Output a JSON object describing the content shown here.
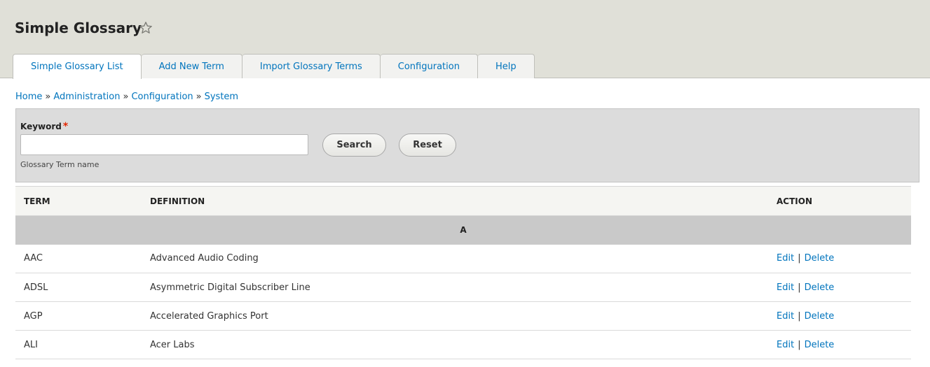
{
  "header": {
    "title": "Simple Glossary",
    "tabs": [
      {
        "label": "Simple Glossary List",
        "active": true
      },
      {
        "label": "Add New Term",
        "active": false
      },
      {
        "label": "Import Glossary Terms",
        "active": false
      },
      {
        "label": "Configuration",
        "active": false
      },
      {
        "label": "Help",
        "active": false
      }
    ]
  },
  "breadcrumb": [
    "Home",
    "Administration",
    "Configuration",
    "System"
  ],
  "breadcrumb_separator": "»",
  "search": {
    "label": "Keyword",
    "required_marker": "*",
    "value": "",
    "description": "Glossary Term name",
    "search_label": "Search",
    "reset_label": "Reset"
  },
  "table": {
    "headers": {
      "term": "TERM",
      "definition": "DEFINITION",
      "action": "ACTION"
    },
    "group_letter": "A",
    "rows": [
      {
        "term": "AAC",
        "definition": "Advanced Audio Coding",
        "edit": "Edit",
        "sep": "|",
        "delete": "Delete"
      },
      {
        "term": "ADSL",
        "definition": "Asymmetric Digital Subscriber Line",
        "edit": "Edit",
        "sep": "|",
        "delete": "Delete"
      },
      {
        "term": "AGP",
        "definition": "Accelerated Graphics Port",
        "edit": "Edit",
        "sep": "|",
        "delete": "Delete"
      },
      {
        "term": "ALI",
        "definition": "Acer Labs",
        "edit": "Edit",
        "sep": "|",
        "delete": "Delete"
      }
    ]
  },
  "colors": {
    "link": "#0074bd",
    "header_bg": "#e0e0d8",
    "required": "#e32700"
  },
  "icons": {
    "favorite": "star-outline-icon"
  }
}
